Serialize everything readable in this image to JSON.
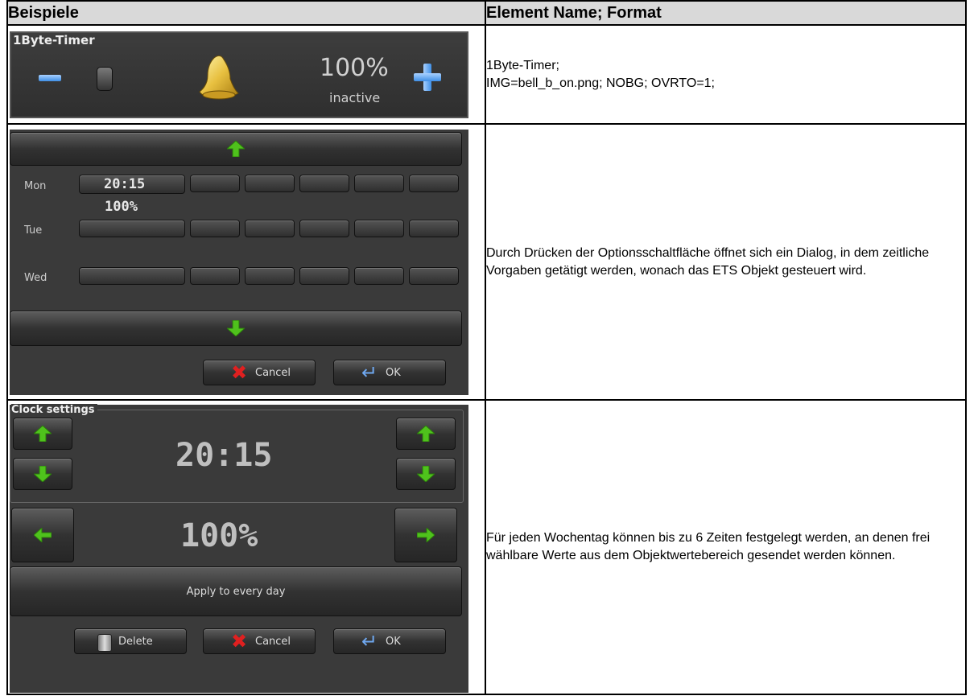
{
  "table": {
    "header": {
      "col1": "Beispiele",
      "col2": "Element Name; Format"
    },
    "rows": [
      {
        "description_lines": [
          "1Byte-Timer;",
          "IMG=bell_b_on.png; NOBG; OVRTO=1;"
        ]
      },
      {
        "description": "Durch Drücken der Optionsschaltfläche öffnet sich ein Dialog, in dem zeitliche Vorgaben getätigt werden, wonach das ETS Objekt gesteuert wird."
      },
      {
        "description": "Für jeden Wochentag können bis zu 6 Zeiten festgelegt werden, an denen frei wählbare Werte aus dem Objektwertebereich gesendet werden können."
      }
    ]
  },
  "timer_widget": {
    "title": "1Byte-Timer",
    "value": "100%",
    "status": "inactive",
    "icons": [
      "minus-icon",
      "toggle-switch",
      "bell-icon",
      "plus-icon"
    ]
  },
  "weekly_dialog": {
    "days": [
      "Mon",
      "Tue",
      "Wed"
    ],
    "mon_first_time": "20:15",
    "mon_first_value": "100%",
    "cancel_label": "Cancel",
    "ok_label": "OK",
    "icons": [
      "arrow-up-icon",
      "arrow-down-icon",
      "cancel-x-icon",
      "enter-icon"
    ]
  },
  "clock_dialog": {
    "title": "Clock settings",
    "time": "20:15",
    "value": "100%",
    "apply_label": "Apply to every day",
    "delete_label": "Delete",
    "cancel_label": "Cancel",
    "ok_label": "OK"
  },
  "colors": {
    "arrow_green": "#4fc21c",
    "panel_bg": "#3a3a3a",
    "header_bg": "#d9d9d9"
  }
}
